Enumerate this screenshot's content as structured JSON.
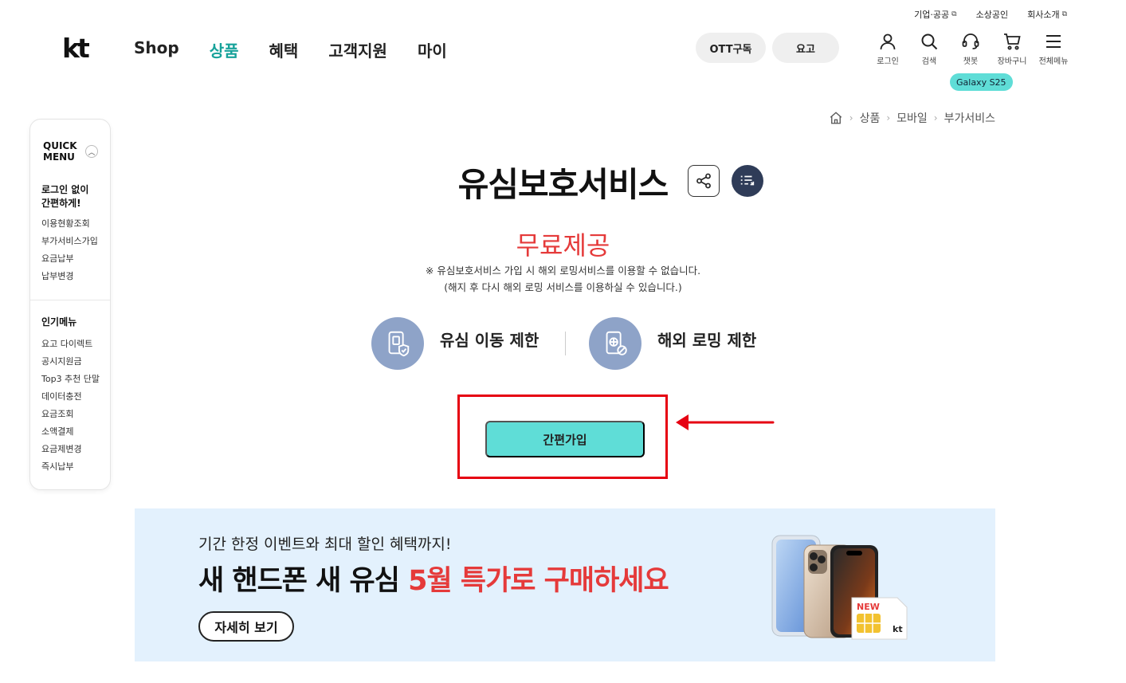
{
  "utility_bar": {
    "business": "기업·공공",
    "small_business": "소상공인",
    "company": "회사소개"
  },
  "header": {
    "logo": "kt",
    "nav": [
      "Shop",
      "상품",
      "혜택",
      "고객지원",
      "마이"
    ],
    "active_nav": "상품",
    "ott_button": "OTT구독",
    "plan_button": "요고",
    "icons": [
      {
        "name": "user-icon",
        "label": "로그인"
      },
      {
        "name": "search-icon",
        "label": "검색"
      },
      {
        "name": "chatbot-icon",
        "label": "챗봇"
      },
      {
        "name": "cart-icon",
        "label": "장바구니"
      },
      {
        "name": "menu-icon",
        "label": "전체메뉴"
      }
    ],
    "promo_badge": "Galaxy S25"
  },
  "breadcrumb": [
    "상품",
    "모바일",
    "부가서비스"
  ],
  "quick_menu": {
    "title_line1": "QUICK",
    "title_line2": "MENU",
    "section1_title_line1": "로그인 없이",
    "section1_title_line2": "간편하게!",
    "section1_items": [
      "이용현황조회",
      "부가서비스가입",
      "요금납부",
      "납부변경"
    ],
    "section2_title": "인기메뉴",
    "section2_items": [
      "요고 다이렉트",
      "공시지원금",
      "Top3 추천 단말",
      "데이터충전",
      "요금조회",
      "소액결제",
      "요금제변경",
      "즉시납부"
    ]
  },
  "main": {
    "title": "유심보호서비스",
    "subtitle": "무료제공",
    "notice_line1": "※ 유심보호서비스 가입 시 해외 로밍서비스를 이용할 수 없습니다.",
    "notice_line2": "(해지 후 다시 해외 로밍 서비스를 이용하실 수 있습니다.)",
    "features": [
      "유심 이동 제한",
      "해외 로밍 제한"
    ],
    "join_button": "간편가입"
  },
  "banner": {
    "small_text": "기간 한정 이벤트와 최대 할인 혜택까지!",
    "big_text_prefix": "새 핸드폰 새 유심 ",
    "big_text_highlight": "5월 특가로 구매하세요",
    "button": "자세히 보기",
    "sim_new_label": "NEW",
    "sim_brand": "kt"
  },
  "colors": {
    "accent": "#17a29a",
    "join_button": "#5fddd7",
    "highlight_red": "#e53a3a",
    "annotation_red": "#e60012",
    "banner_bg": "#e3f1fd",
    "feature_circle": "#8ea3c8"
  }
}
